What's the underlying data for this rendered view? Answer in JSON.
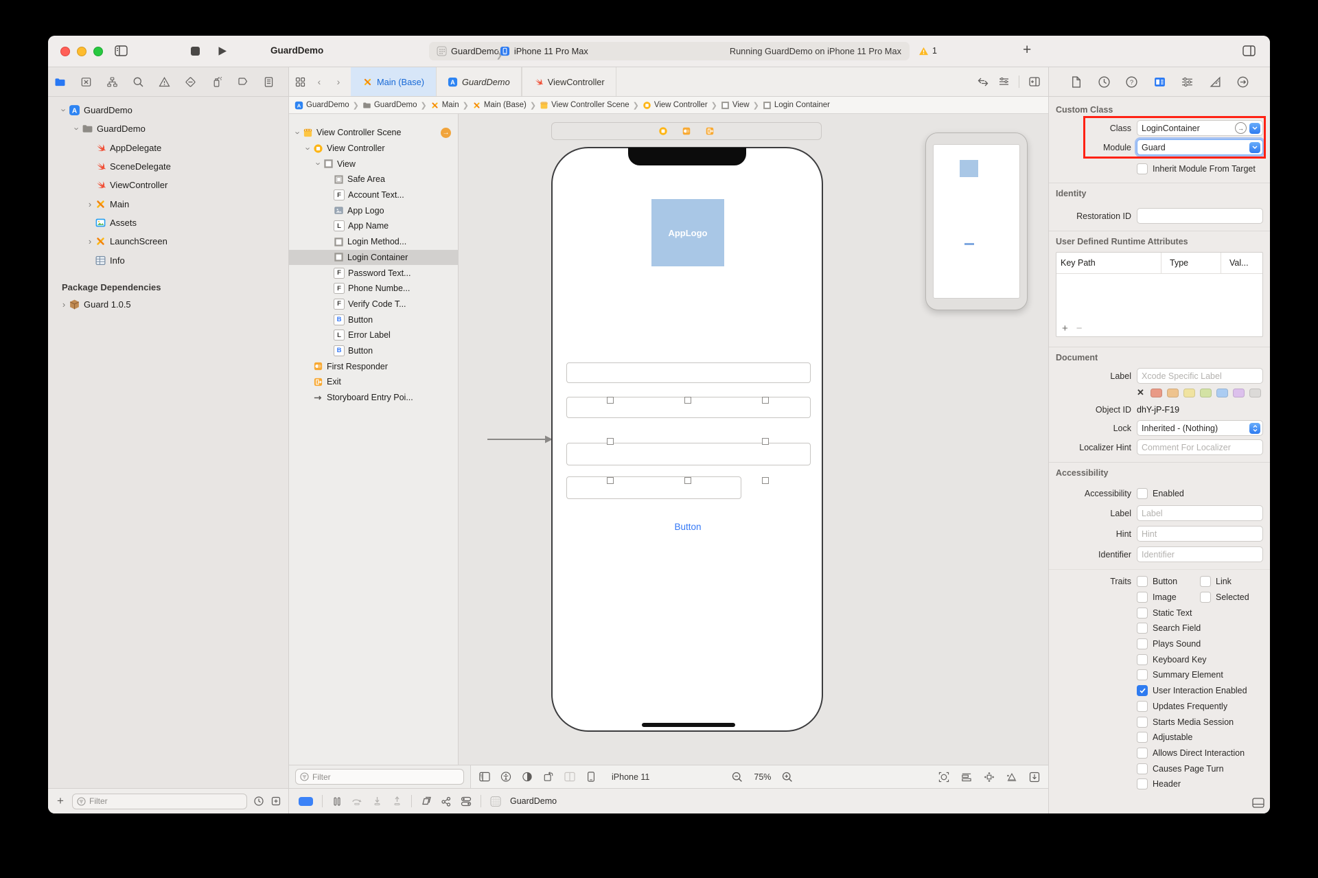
{
  "toolbar": {
    "project_title": "GuardDemo",
    "scheme_target": "GuardDemo",
    "scheme_device": "iPhone 11 Pro Max",
    "status": "Running GuardDemo on iPhone 11 Pro Max",
    "warning_count": "1"
  },
  "navigator": {
    "tab_icons": [
      "project-navigator-icon",
      "source-control-icon",
      "symbol-navigator-icon",
      "find-navigator-icon",
      "issue-navigator-icon",
      "test-navigator-icon",
      "debug-navigator-icon",
      "breakpoint-navigator-icon",
      "report-navigator-icon"
    ],
    "items": [
      {
        "label": "GuardDemo",
        "icon": "app-project-icon",
        "level": 0,
        "disclosure": "open"
      },
      {
        "label": "GuardDemo",
        "icon": "folder-icon",
        "level": 1,
        "disclosure": "open"
      },
      {
        "label": "AppDelegate",
        "icon": "swift-file-icon",
        "level": 2
      },
      {
        "label": "SceneDelegate",
        "icon": "swift-file-icon",
        "level": 2
      },
      {
        "label": "ViewController",
        "icon": "swift-file-icon",
        "level": 2
      },
      {
        "label": "Main",
        "icon": "storyboard-icon",
        "level": 2,
        "disclosure": "closed"
      },
      {
        "label": "Assets",
        "icon": "assets-icon",
        "level": 2
      },
      {
        "label": "LaunchScreen",
        "icon": "storyboard-icon",
        "level": 2,
        "disclosure": "closed"
      },
      {
        "label": "Info",
        "icon": "plist-icon",
        "level": 2
      }
    ],
    "section_header": "Package Dependencies",
    "packages": [
      {
        "label": "Guard 1.0.5",
        "icon": "package-icon",
        "disclosure": "closed"
      }
    ],
    "filter_placeholder": "Filter"
  },
  "editor": {
    "tabs": [
      {
        "label": "Main (Base)",
        "icon": "storyboard-icon",
        "active": true
      },
      {
        "label": "GuardDemo",
        "icon": "app-project-icon",
        "italic": true
      },
      {
        "label": "ViewController",
        "icon": "swift-file-icon"
      }
    ],
    "breadcrumbs": [
      {
        "label": "GuardDemo",
        "icon": "app-project-icon"
      },
      {
        "label": "GuardDemo",
        "icon": "folder-icon"
      },
      {
        "label": "Main",
        "icon": "storyboard-icon"
      },
      {
        "label": "Main (Base)",
        "icon": "storyboard-icon"
      },
      {
        "label": "View Controller Scene",
        "icon": "scene-icon"
      },
      {
        "label": "View Controller",
        "icon": "view-controller-icon"
      },
      {
        "label": "View",
        "icon": "view-icon"
      },
      {
        "label": "Login Container",
        "icon": "view-icon"
      }
    ]
  },
  "outline": {
    "items": [
      {
        "label": "View Controller Scene",
        "icon": "scene-icon",
        "level": 0,
        "disclosure": "open",
        "dock_arrow": true
      },
      {
        "label": "View Controller",
        "icon": "view-controller-icon",
        "level": 1,
        "disclosure": "open"
      },
      {
        "label": "View",
        "icon": "view-icon",
        "level": 2,
        "disclosure": "open"
      },
      {
        "label": "Safe Area",
        "icon": "safe-area-icon",
        "level": 3
      },
      {
        "label": "Account Text...",
        "icon": "textfield-icon",
        "level": 3
      },
      {
        "label": "App Logo",
        "icon": "imageview-icon",
        "level": 3
      },
      {
        "label": "App Name",
        "icon": "label-icon",
        "level": 3
      },
      {
        "label": "Login Method...",
        "icon": "view-icon",
        "level": 3
      },
      {
        "label": "Login Container",
        "icon": "view-icon",
        "level": 3,
        "selected": true
      },
      {
        "label": "Password Text...",
        "icon": "textfield-icon",
        "level": 3
      },
      {
        "label": "Phone Numbe...",
        "icon": "textfield-icon",
        "level": 3
      },
      {
        "label": "Verify Code T...",
        "icon": "textfield-icon",
        "level": 3
      },
      {
        "label": "Button",
        "icon": "button-icon",
        "level": 3
      },
      {
        "label": "Error Label",
        "icon": "label-icon",
        "level": 3
      },
      {
        "label": "Button",
        "icon": "button-icon",
        "level": 3
      },
      {
        "label": "First Responder",
        "icon": "first-responder-icon",
        "level": 1
      },
      {
        "label": "Exit",
        "icon": "exit-icon",
        "level": 1
      },
      {
        "label": "Storyboard Entry Poi...",
        "icon": "entry-point-icon",
        "level": 1
      }
    ],
    "filter_placeholder": "Filter"
  },
  "canvas": {
    "app_logo_label": "AppLogo",
    "button_label": "Button",
    "device": "iPhone 11",
    "zoom": "75%"
  },
  "debugbar": {
    "app_label": "GuardDemo"
  },
  "inspector": {
    "custom_class": {
      "header": "Custom Class",
      "class_label": "Class",
      "class_value": "LoginContainer",
      "module_label": "Module",
      "module_value": "Guard",
      "inherit_label": "Inherit Module From Target"
    },
    "identity": {
      "header": "Identity",
      "restoration_label": "Restoration ID"
    },
    "runtime_attributes": {
      "header": "User Defined Runtime Attributes",
      "columns": [
        "Key Path",
        "Type",
        "Val..."
      ]
    },
    "document": {
      "header": "Document",
      "label_label": "Label",
      "label_placeholder": "Xcode Specific Label",
      "object_id_label": "Object ID",
      "object_id": "dhY-jP-F19",
      "lock_label": "Lock",
      "lock_value": "Inherited - (Nothing)",
      "localizer_label": "Localizer Hint",
      "localizer_placeholder": "Comment For Localizer",
      "swatch_colors": [
        "#e99a86",
        "#eec38e",
        "#f0e3a0",
        "#d3e2a4",
        "#abccf2",
        "#dcc0ec",
        "#dcdad8"
      ]
    },
    "accessibility": {
      "header": "Accessibility",
      "enabled_row_label": "Accessibility",
      "enabled_label": "Enabled",
      "label_label": "Label",
      "label_placeholder": "Label",
      "hint_label": "Hint",
      "hint_placeholder": "Hint",
      "identifier_label": "Identifier",
      "identifier_placeholder": "Identifier",
      "traits_label": "Traits",
      "traits": [
        {
          "label": "Button",
          "checked": false,
          "second": {
            "label": "Link",
            "checked": false
          }
        },
        {
          "label": "Image",
          "checked": false,
          "second": {
            "label": "Selected",
            "checked": false
          }
        },
        {
          "label": "Static Text",
          "checked": false
        },
        {
          "label": "Search Field",
          "checked": false
        },
        {
          "label": "Plays Sound",
          "checked": false
        },
        {
          "label": "Keyboard Key",
          "checked": false
        },
        {
          "label": "Summary Element",
          "checked": false
        },
        {
          "label": "User Interaction Enabled",
          "checked": true
        },
        {
          "label": "Updates Frequently",
          "checked": false
        },
        {
          "label": "Starts Media Session",
          "checked": false
        },
        {
          "label": "Adjustable",
          "checked": false
        },
        {
          "label": "Allows Direct Interaction",
          "checked": false
        },
        {
          "label": "Causes Page Turn",
          "checked": false
        },
        {
          "label": "Header",
          "checked": false
        }
      ]
    }
  }
}
